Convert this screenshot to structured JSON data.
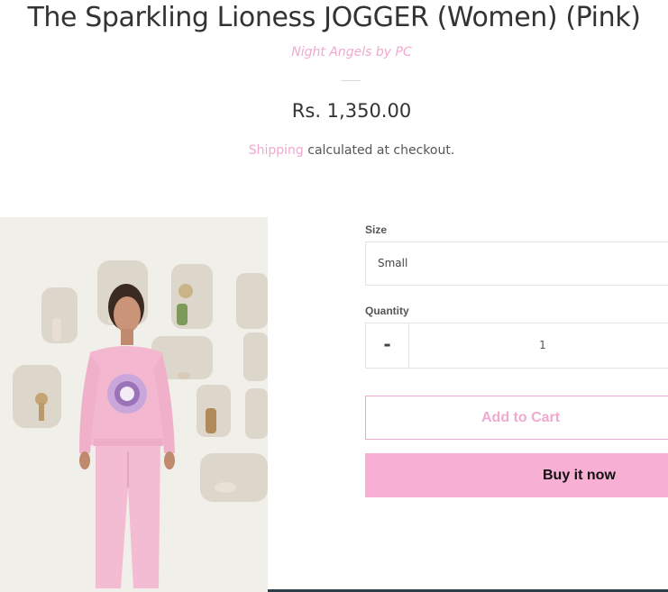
{
  "product": {
    "title": "The Sparkling Lioness JOGGER (Women) (Pink)",
    "vendor": "Night Angels by PC",
    "price": "Rs. 1,350.00",
    "shipping_link": "Shipping",
    "shipping_text": " calculated at checkout."
  },
  "form": {
    "size_label": "Size",
    "size_value": "Small",
    "quantity_label": "Quantity",
    "quantity_minus": "-",
    "quantity_value": "1",
    "add_to_cart": "Add to Cart",
    "buy_now": "Buy it now"
  },
  "colors": {
    "accent_pink": "#f0a9cf",
    "buy_button_bg": "#f7afd3",
    "text": "#333333"
  }
}
